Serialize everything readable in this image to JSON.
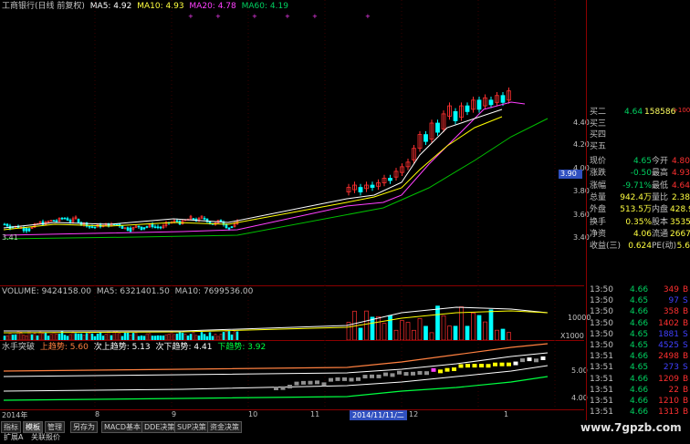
{
  "header": {
    "title": "工商银行(日线 前复权)",
    "ma5": "MA5: 4.92",
    "ma10": "MA10: 4.93",
    "ma20": "MA20: 4.78",
    "ma60": "MA60: 4.19"
  },
  "price_axis": [
    "4.40",
    "4.20",
    "4.00",
    "3.80",
    "3.60",
    "3.40"
  ],
  "price_badge": "3.90",
  "left_price_label": "3.41",
  "volume_header": {
    "title": "VOLUME: 9424158.00",
    "ma5": "MA5: 6321401.50",
    "ma10": "MA10: 7699536.00"
  },
  "volume_axis": [
    "10000"
  ],
  "volume_unit": "X1000",
  "indicator_header": {
    "name": "水手突破",
    "up": "上趋势: 5.60",
    "sub_up": "次上趋势: 5.13",
    "sub_down": "次下趋势: 4.41",
    "down": "下趋势: 3.92"
  },
  "indicator_axis": [
    "5.00",
    "4.00"
  ],
  "date_axis": {
    "start": "2014年",
    "labels": [
      "8",
      "9",
      "10",
      "11",
      "12",
      "1"
    ],
    "cursor_date": "2014/11/11/二"
  },
  "order_book": [
    {
      "label": "买二",
      "price": "4.64",
      "vol": "158586",
      "chg": ""
    },
    {
      "label": "买三",
      "price": "",
      "vol": "",
      "chg": ""
    },
    {
      "label": "买四",
      "price": "",
      "vol": "",
      "chg": ""
    },
    {
      "label": "买五",
      "price": "",
      "vol": "",
      "chg": ""
    }
  ],
  "top_mark": "+100",
  "quote": [
    {
      "l1": "现价",
      "v1": "4.65",
      "l2": "今开",
      "v2": "4.80"
    },
    {
      "l1": "涨跌",
      "v1": "-0.50",
      "l2": "最高",
      "v2": "4.93"
    },
    {
      "l1": "涨幅",
      "v1": "-9.71%",
      "l2": "最低",
      "v2": "4.64"
    },
    {
      "l1": "总量",
      "v1": "942.4万",
      "l2": "量比",
      "v2": "2.38"
    },
    {
      "l1": "外盘",
      "v1": "513.5万",
      "l2": "内盘",
      "v2": "428.9万"
    },
    {
      "l1": "换手",
      "v1": "0.35%",
      "l2": "股本",
      "v2": "3535亿"
    },
    {
      "l1": "净资",
      "v1": "4.06",
      "l2": "流通",
      "v2": "2667亿"
    },
    {
      "l1": "收益(三)",
      "v1": "0.624",
      "l2": "PE(动)",
      "v2": "5.6"
    }
  ],
  "ticks": [
    {
      "time": "13:50",
      "price": "4.66",
      "vol": "349",
      "side": "B"
    },
    {
      "time": "13:50",
      "price": "4.65",
      "vol": "97",
      "side": "S"
    },
    {
      "time": "13:50",
      "price": "4.66",
      "vol": "358",
      "side": "B"
    },
    {
      "time": "13:50",
      "price": "4.66",
      "vol": "1402",
      "side": "B"
    },
    {
      "time": "13:50",
      "price": "4.65",
      "vol": "1881",
      "side": "S"
    },
    {
      "time": "13:50",
      "price": "4.65",
      "vol": "4525",
      "side": "S"
    },
    {
      "time": "13:51",
      "price": "4.66",
      "vol": "2498",
      "side": "B"
    },
    {
      "time": "13:51",
      "price": "4.65",
      "vol": "273",
      "side": "S"
    },
    {
      "time": "13:51",
      "price": "4.66",
      "vol": "1209",
      "side": "B"
    },
    {
      "time": "13:51",
      "price": "4.66",
      "vol": "22",
      "side": "B"
    },
    {
      "time": "13:51",
      "price": "4.66",
      "vol": "1210",
      "side": "B"
    },
    {
      "time": "13:51",
      "price": "4.66",
      "vol": "1313",
      "side": "B"
    }
  ],
  "tabs": [
    "指标",
    "模板",
    "管理",
    "另存为",
    "MACD基本",
    "DDE决策",
    "SUP决策",
    "资金决策"
  ],
  "tabs_row2": [
    "扩展A",
    "关联报价"
  ],
  "watermark": "www.7gpzb.com",
  "colors": {
    "up": "#ff3030",
    "down": "#00ffff",
    "ma5": "#ffffff",
    "ma10": "#ffff00",
    "ma20": "#ff40ff",
    "ma60": "#00c000",
    "grid": "#8b0000"
  }
}
